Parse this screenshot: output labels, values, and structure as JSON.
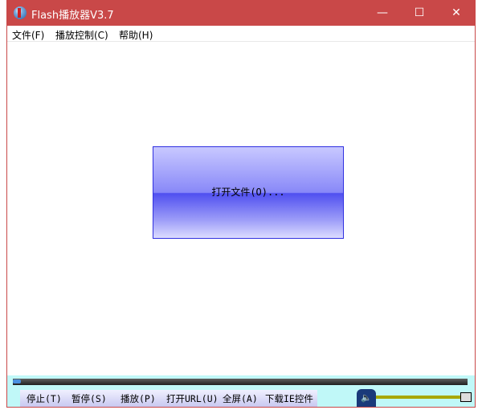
{
  "window": {
    "title": "Flash播放器V3.7",
    "minimize": "—",
    "maximize": "☐",
    "close": "✕"
  },
  "menu": [
    "文件(F)",
    "播放控制(C)",
    "帮助(H)"
  ],
  "main": {
    "open_button": "打开文件(O)..."
  },
  "controls": {
    "buttons": [
      "停止(T)",
      "暂停(S)",
      "播放(P)",
      "打开URL(U)",
      "全屏(A)",
      "下载IE控件"
    ],
    "volume_icon": "🔈",
    "seek_progress": 0
  }
}
